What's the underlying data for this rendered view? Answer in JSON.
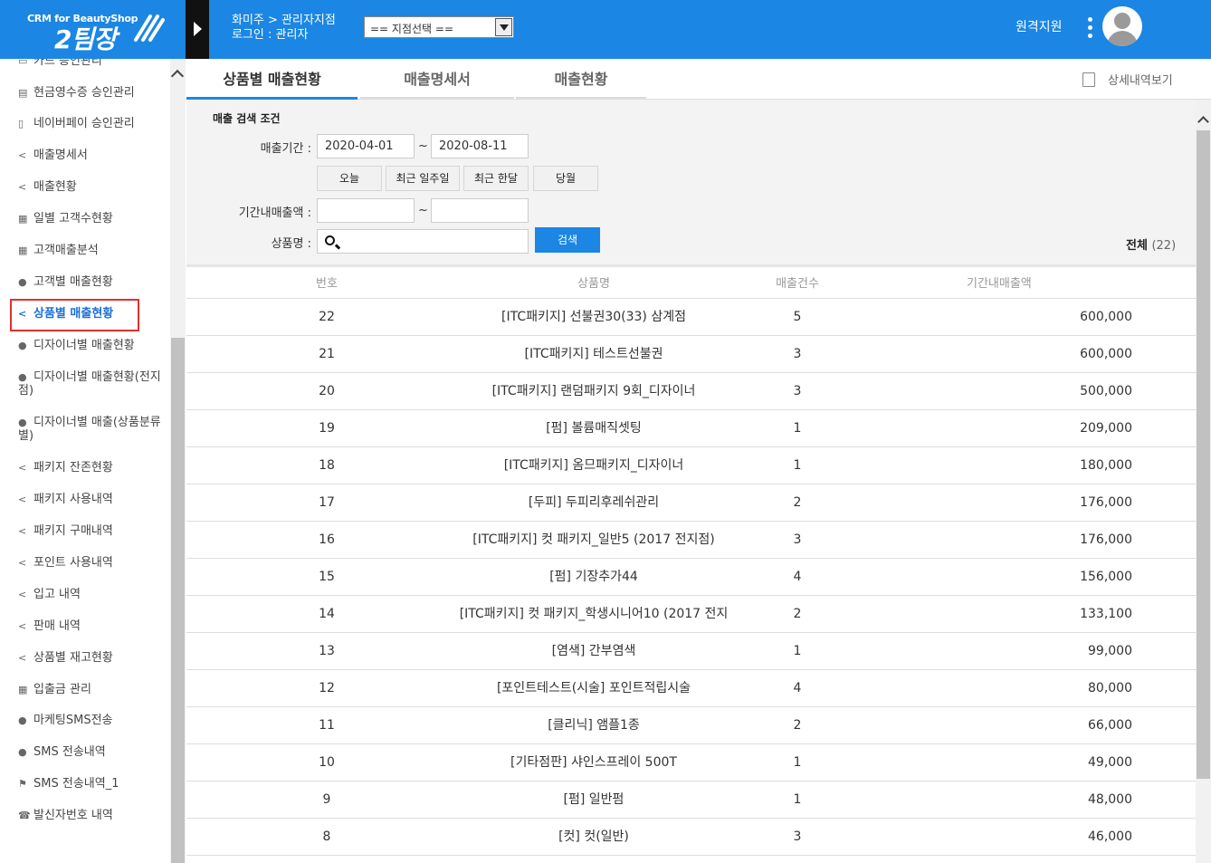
{
  "header": {
    "logo_sub": "CRM for BeautyShop",
    "logo_main": "2팀장",
    "shop_line": "화미주 > 관리자지점",
    "login_line": "로그인 : 관리자",
    "branch_select": "== 지점선택 ==",
    "remote_support": "원격지원"
  },
  "sidebar": {
    "items": [
      {
        "label": "카드 승인관리",
        "icon": "card-icon"
      },
      {
        "label": "현금영수증 승인관리",
        "icon": "receipt-icon"
      },
      {
        "label": "네이버페이 승인관리",
        "icon": "mobile-icon"
      },
      {
        "label": "매출명세서",
        "icon": "share-icon"
      },
      {
        "label": "매출현황",
        "icon": "share-icon"
      },
      {
        "label": "일별 고객수현황",
        "icon": "chart-icon"
      },
      {
        "label": "고객매출분석",
        "icon": "chart-icon"
      },
      {
        "label": "고객별 매출현황",
        "icon": "user-icon"
      },
      {
        "label": "상품별 매출현황",
        "icon": "share-icon"
      },
      {
        "label": "디자이너별 매출현황",
        "icon": "user-icon"
      },
      {
        "label": "디자이너별 매출현황(전지점)",
        "icon": "user-icon"
      },
      {
        "label": "디자이너별 매출(상품분류별)",
        "icon": "user-icon"
      },
      {
        "label": "패키지 잔존현황",
        "icon": "share-icon"
      },
      {
        "label": "패키지 사용내역",
        "icon": "share-icon"
      },
      {
        "label": "패키지 구매내역",
        "icon": "share-icon"
      },
      {
        "label": "포인트 사용내역",
        "icon": "share-icon"
      },
      {
        "label": "입고 내역",
        "icon": "share-icon"
      },
      {
        "label": "판매 내역",
        "icon": "share-icon"
      },
      {
        "label": "상품별 재고현황",
        "icon": "share-icon"
      },
      {
        "label": "입출금 관리",
        "icon": "calculator-icon"
      },
      {
        "label": "마케팅SMS전송",
        "icon": "comment-icon"
      },
      {
        "label": "SMS 전송내역",
        "icon": "comment-icon"
      },
      {
        "label": "SMS 전송내역_1",
        "icon": "flag-icon"
      },
      {
        "label": "발신자번호 내역",
        "icon": "phone-icon"
      }
    ]
  },
  "tabs": [
    {
      "label": "상품별 매출현황",
      "active": true
    },
    {
      "label": "매출명세서",
      "active": false
    },
    {
      "label": "매출현황",
      "active": false
    }
  ],
  "detail_link": "상세내역보기",
  "search": {
    "title": "매출 검색 조건",
    "period_label": "매출기간 :",
    "date_from": "2020-04-01",
    "date_to": "2020-08-11",
    "tilde": "~",
    "quick": [
      "오늘",
      "최근 일주일",
      "최근 한달",
      "당월"
    ],
    "amount_label": "기간내매출액 :",
    "product_label": "상품명 :",
    "search_button": "검색",
    "total_label": "전체",
    "total_count": "(22)"
  },
  "table": {
    "headers": [
      "번호",
      "상품명",
      "매출건수",
      "기간내매출액"
    ],
    "rows": [
      [
        "22",
        "[ITC패키지] 선불권30(33) 삼계점",
        "5",
        "600,000"
      ],
      [
        "21",
        "[ITC패키지] 테스트선불권",
        "3",
        "600,000"
      ],
      [
        "20",
        "[ITC패키지] 랜덤패키지 9회_디자이너",
        "3",
        "500,000"
      ],
      [
        "19",
        "[펌] 볼륨매직셋팅",
        "1",
        "209,000"
      ],
      [
        "18",
        "[ITC패키지] 옴므패키지_디자이너",
        "1",
        "180,000"
      ],
      [
        "17",
        "[두피] 두피리후레쉬관리",
        "2",
        "176,000"
      ],
      [
        "16",
        "[ITC패키지] 컷 패키지_일반5 (2017 전지점)",
        "3",
        "176,000"
      ],
      [
        "15",
        "[펌] 기장추가44",
        "4",
        "156,000"
      ],
      [
        "14",
        "[ITC패키지] 컷 패키지_학생시니어10 (2017 전지",
        "2",
        "133,100"
      ],
      [
        "13",
        "[염색] 간부염색",
        "1",
        "99,000"
      ],
      [
        "12",
        "[포인트테스트(시술] 포인트적립시술",
        "4",
        "80,000"
      ],
      [
        "11",
        "[클리닉] 앰플1종",
        "2",
        "66,000"
      ],
      [
        "10",
        "[기타점판] 샤인스프레이 500T",
        "1",
        "49,000"
      ],
      [
        "9",
        "[펌] 일반펌",
        "1",
        "48,000"
      ],
      [
        "8",
        "[컷] 컷(일반)",
        "3",
        "46,000"
      ]
    ]
  }
}
